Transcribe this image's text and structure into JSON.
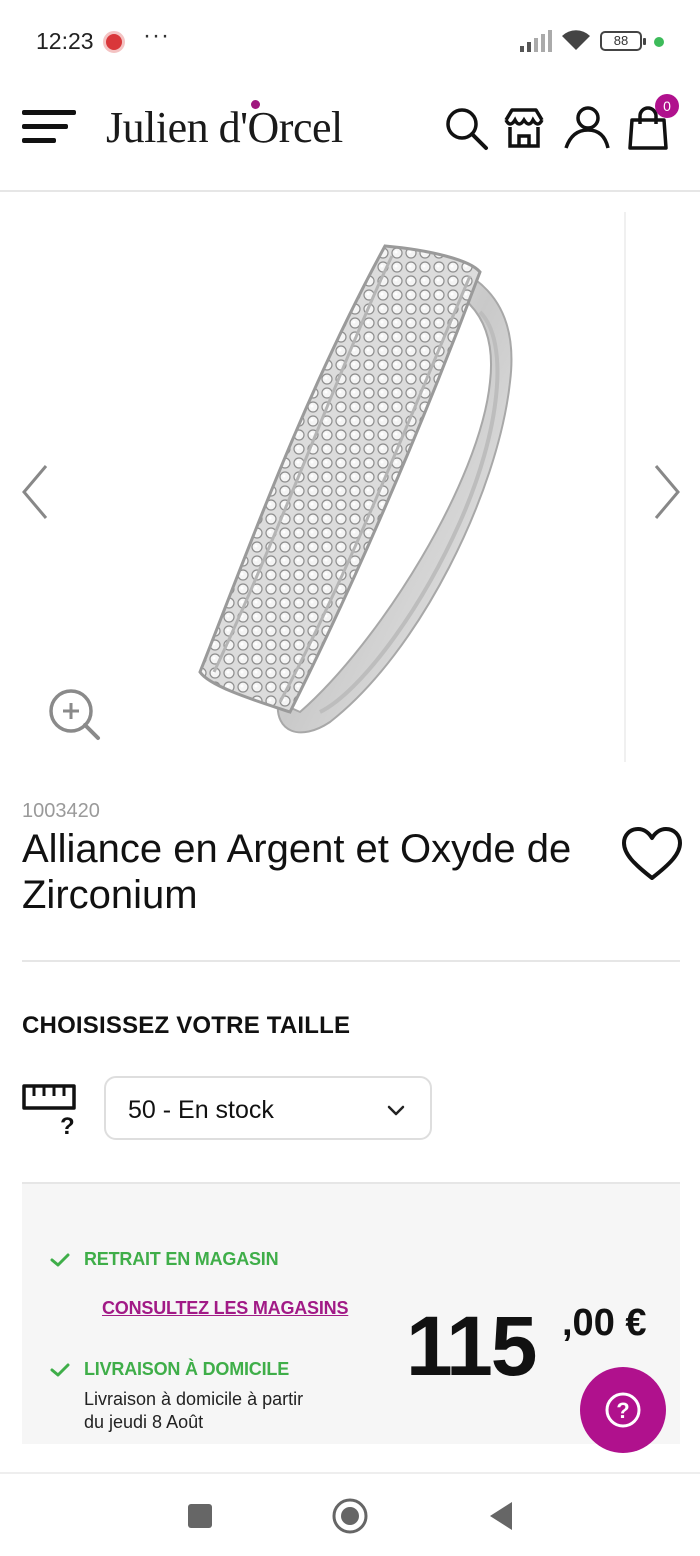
{
  "status_bar": {
    "time": "12:23",
    "more": "···",
    "battery": "88"
  },
  "header": {
    "logo": "Julien d'Orcel",
    "cart_count": "0",
    "icons": [
      "menu-icon",
      "search-icon",
      "store-icon",
      "account-icon",
      "shopping-bag-icon"
    ]
  },
  "product": {
    "sku": "1003420",
    "title": "Alliance en Argent et Oxyde de Zirconium",
    "image": "silver-pave-ring"
  },
  "size": {
    "heading": "CHOISISSEZ VOTRE TAILLE",
    "selected": "50 - En stock"
  },
  "delivery": {
    "pickup_label": "RETRAIT EN MAGASIN",
    "stores_link": "CONSULTEZ LES MAGASINS",
    "home_label": "LIVRAISON À DOMICILE",
    "home_text": "Livraison à domicile à partir du jeudi 8 Août"
  },
  "price": {
    "integer": "115",
    "cents": ",00 €"
  },
  "colors": {
    "brand": "#b0118d",
    "success": "#3fae49"
  }
}
